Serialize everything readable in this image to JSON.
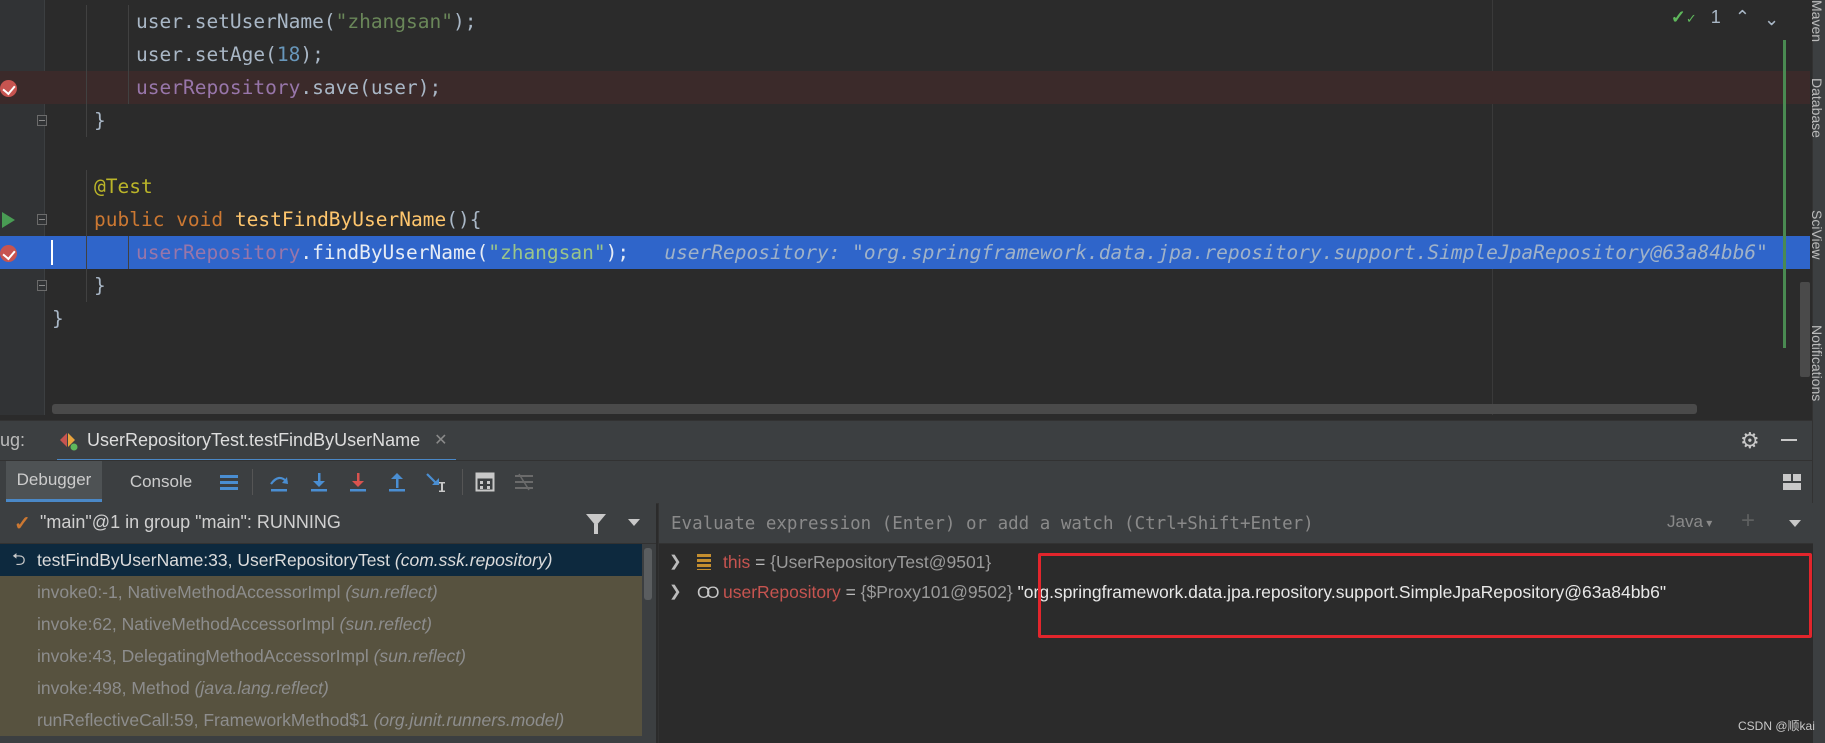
{
  "editor": {
    "lines": [
      {
        "indent": 2,
        "tokens": [
          [
            "pl",
            "user.setUserName("
          ],
          [
            "str",
            "\"zhangsan\""
          ],
          [
            "pl",
            ");"
          ]
        ]
      },
      {
        "indent": 2,
        "tokens": [
          [
            "pl",
            "user.setAge("
          ],
          [
            "num",
            "18"
          ],
          [
            "pl",
            ");"
          ]
        ]
      },
      {
        "indent": 2,
        "tokens": [
          [
            "fld",
            "userRepository"
          ],
          [
            "pl",
            ".save(user);"
          ]
        ]
      },
      {
        "indent": 1,
        "tokens": [
          [
            "pl",
            "}"
          ]
        ]
      },
      {
        "indent": 0,
        "tokens": []
      },
      {
        "indent": 1,
        "tokens": [
          [
            "ann",
            "@Test"
          ]
        ]
      },
      {
        "indent": 1,
        "tokens": [
          [
            "kw",
            "public void "
          ],
          [
            "mth",
            "testFindByUserName"
          ],
          [
            "pl",
            "(){"
          ]
        ]
      },
      {
        "indent": 2,
        "tokens": [
          [
            "fld",
            "userRepository"
          ],
          [
            "pl",
            ".findByUserName("
          ],
          [
            "str",
            "\"zhangsan\""
          ],
          [
            "pl",
            ");"
          ],
          [
            "inl",
            "   userRepository: \"org.springframework.data.jpa.repository.support.SimpleJpaRepository@63a84bb6\""
          ]
        ]
      },
      {
        "indent": 1,
        "tokens": [
          [
            "pl",
            "}"
          ]
        ]
      },
      {
        "indent": 0,
        "tokens": [
          [
            "pl",
            "}"
          ]
        ]
      }
    ],
    "inspection_count": "1",
    "right_tool_windows": [
      "Maven",
      "Database",
      "SciView",
      "Notifications"
    ]
  },
  "debug": {
    "label": "ug:",
    "session_tab": "UserRepositoryTest.testFindByUserName",
    "tabs": {
      "debugger": "Debugger",
      "console": "Console"
    },
    "thread": "\"main\"@1 in group \"main\": RUNNING",
    "frames": [
      {
        "name": "testFindByUserName:33, UserRepositoryTest",
        "ctx": "(com.ssk.repository)",
        "selected": true
      },
      {
        "name": "invoke0:-1, NativeMethodAccessorImpl",
        "ctx": "(sun.reflect)",
        "selected": false
      },
      {
        "name": "invoke:62, NativeMethodAccessorImpl",
        "ctx": "(sun.reflect)",
        "selected": false
      },
      {
        "name": "invoke:43, DelegatingMethodAccessorImpl",
        "ctx": "(sun.reflect)",
        "selected": false
      },
      {
        "name": "invoke:498, Method",
        "ctx": "(java.lang.reflect)",
        "selected": false
      },
      {
        "name": "runReflectiveCall:59, FrameworkMethod$1",
        "ctx": "(org.junit.runners.model)",
        "selected": false
      }
    ],
    "eval_placeholder": "Evaluate expression (Enter) or add a watch (Ctrl+Shift+Enter)",
    "language": "Java",
    "variables": [
      {
        "name": "this",
        "eq": " = ",
        "value": "{UserRepositoryTest@9501}",
        "string": "",
        "icon": "fields-icon"
      },
      {
        "name": "userRepository",
        "eq": " = ",
        "value": "{$Proxy101@9502}",
        "string": " \"org.springframework.data.jpa.repository.support.SimpleJpaRepository@63a84bb6\"",
        "icon": "watch-icon"
      }
    ]
  },
  "watermark": "CSDN @顺kai",
  "colors": {
    "selection": "#2f65ca",
    "breakpoint": "#c75450",
    "highlight_box": "#e2252c",
    "accent": "#4a88c7"
  }
}
